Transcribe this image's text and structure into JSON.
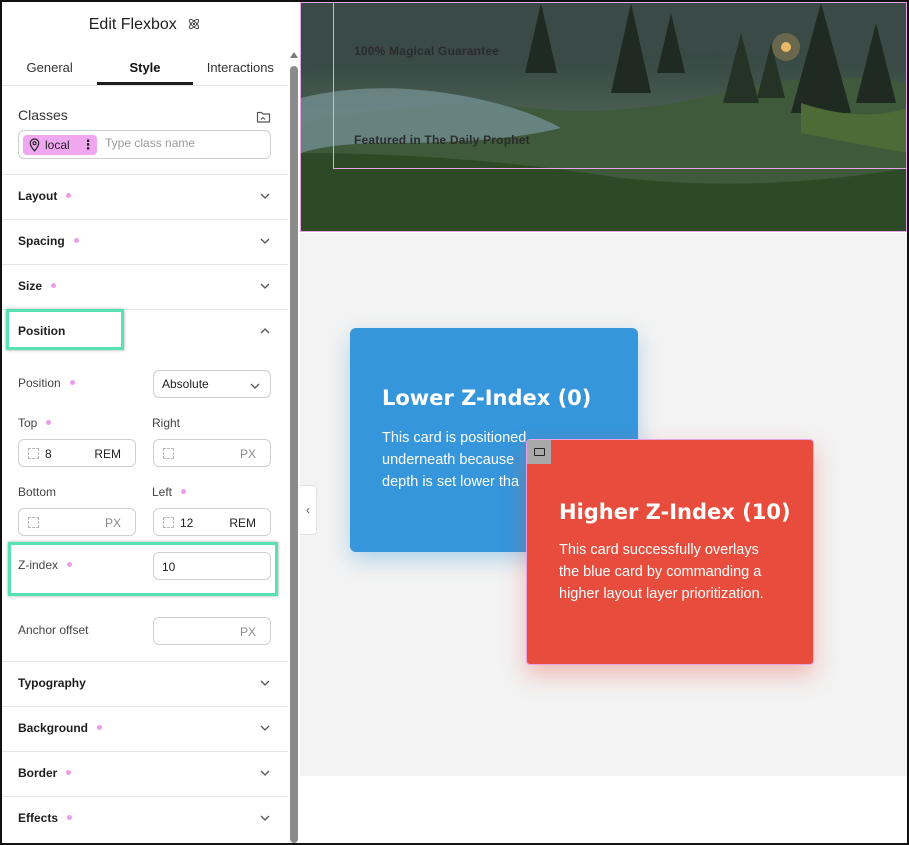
{
  "panel": {
    "title": "Edit Flexbox",
    "tabs": [
      {
        "label": "General",
        "active": false
      },
      {
        "label": "Style",
        "active": true
      },
      {
        "label": "Interactions",
        "active": false
      }
    ],
    "classes": {
      "label": "Classes",
      "chip_label": "local",
      "input_placeholder": "Type class name"
    },
    "sections": {
      "layout": "Layout",
      "spacing": "Spacing",
      "size": "Size",
      "position": "Position",
      "typography": "Typography",
      "background": "Background",
      "border": "Border",
      "effects": "Effects"
    },
    "position_fields": {
      "position_label": "Position",
      "position_value": "Absolute",
      "top_label": "Top",
      "top_value": "8",
      "top_unit": "REM",
      "right_label": "Right",
      "right_value": "",
      "right_unit": "PX",
      "bottom_label": "Bottom",
      "bottom_value": "",
      "bottom_unit": "PX",
      "left_label": "Left",
      "left_value": "12",
      "left_unit": "REM",
      "zindex_label": "Z-index",
      "zindex_value": "10",
      "anchor_label": "Anchor offset",
      "anchor_value": "",
      "anchor_unit": "PX"
    }
  },
  "canvas": {
    "hero_lines": [
      "100% Magical Guarantee",
      "Featured in The Daily Prophet"
    ],
    "card_lower": {
      "title": "Lower Z-Index (0)",
      "body_lines": [
        "This card is positioned",
        "underneath because",
        "depth is set lower tha"
      ]
    },
    "card_higher": {
      "title": "Higher Z-Index (10)",
      "body_lines": [
        "This card successfully overlays",
        "the blue card by commanding a",
        "higher layout layer prioritization."
      ]
    }
  },
  "colors": {
    "highlight": "#58e1b5",
    "modified_dot": "#ec9cec",
    "card_blue": "#3596db",
    "card_red": "#e74c3c",
    "class_chip": "#f0a7f0"
  },
  "icons": [
    "atom-icon",
    "folder-icon",
    "location-pin-icon",
    "more-vertical-icon",
    "chevron-down-icon",
    "chevron-up-icon",
    "dashed-box-icon",
    "chevron-left-icon"
  ]
}
